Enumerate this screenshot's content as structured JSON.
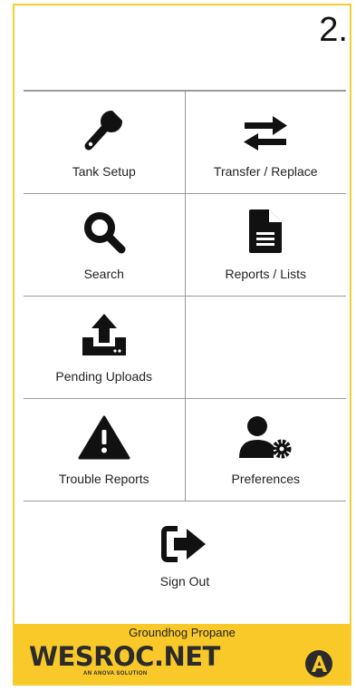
{
  "step_number": "2.",
  "menu": {
    "tank_setup": "Tank Setup",
    "transfer_replace": "Transfer / Replace",
    "search": "Search",
    "reports_lists": "Reports / Lists",
    "pending_uploads": "Pending Uploads",
    "trouble_reports": "Trouble Reports",
    "preferences": "Preferences",
    "sign_out": "Sign Out"
  },
  "icons": {
    "tank_setup": "wrench-icon",
    "transfer_replace": "swap-arrows-icon",
    "search": "search-icon",
    "reports_lists": "document-icon",
    "pending_uploads": "upload-icon",
    "trouble_reports": "warning-icon",
    "preferences": "user-settings-icon",
    "sign_out": "sign-out-icon"
  },
  "footer": {
    "company": "Groundhog Propane",
    "logo_text": "WESROC.NET",
    "tagline": "AN ANOVA SOLUTION"
  },
  "colors": {
    "accent": "#f9c929",
    "frame_border": "#f5cf2f",
    "divider": "#9a9a9a",
    "icon": "#111111"
  }
}
